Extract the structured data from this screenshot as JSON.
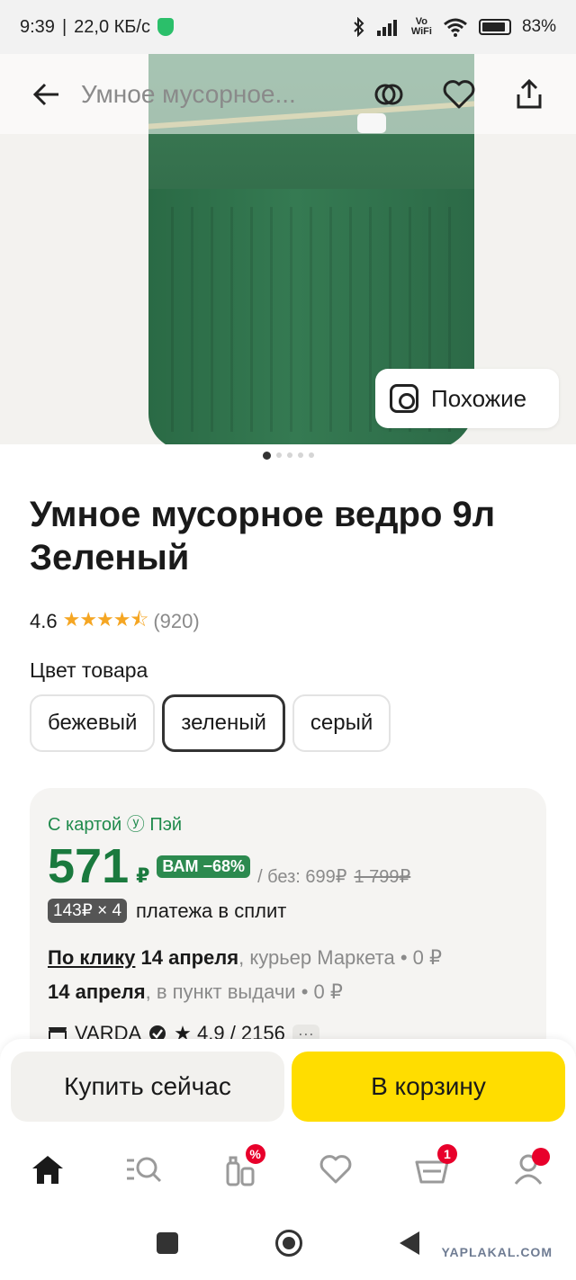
{
  "status_bar": {
    "time": "9:39",
    "net_speed": "22,0 КБ/с",
    "vo_top": "Vo",
    "vo_bottom": "WiFi",
    "battery": "83%"
  },
  "top_nav": {
    "title": "Умное мусорное...",
    "icons": [
      "back-arrow-icon",
      "compare-icon",
      "heart-icon",
      "share-icon"
    ]
  },
  "gallery": {
    "similar_label": "Похожие",
    "pages_total": 5,
    "current_page": 1
  },
  "product": {
    "title": "Умное мусорное ведро 9л Зеленый",
    "rating": "4.6",
    "rating_stars": 4.5,
    "reviews": "(920)",
    "color_label": "Цвет товара",
    "colors": [
      "бежевый",
      "зеленый",
      "серый"
    ],
    "selected_color": "зеленый"
  },
  "price_card": {
    "promo": "С картой ⓨ Пэй",
    "price": "571",
    "currency": "₽",
    "discount_badge": "ВАМ −68%",
    "without_label": "/ без: 699₽",
    "old_price": "1 799₽",
    "split_badge": "143₽ × 4",
    "split_text": "платежа в сплит",
    "delivery1_link": "По клику",
    "delivery1_date": "14 апреля",
    "delivery1_rest": ", курьер Маркета • 0 ₽",
    "delivery2_date": "14 апреля",
    "delivery2_rest": ", в пункт выдачи • 0 ₽",
    "seller_name": "VARDA",
    "seller_rating": "★ 4.9 / 2156",
    "more": "···"
  },
  "actions": {
    "buy_now": "Купить сейчас",
    "to_cart": "В корзину"
  },
  "tab_bar": {
    "tabs": [
      "home-icon",
      "catalog-search-icon",
      "discounts-icon",
      "favorites-icon",
      "cart-icon",
      "profile-icon"
    ],
    "discounts_badge": "%",
    "cart_badge": "1"
  },
  "watermark": "YAPLAKAL.COM",
  "colors": {
    "accent_green": "#1a7a3e",
    "badge_green": "#2c8a4f",
    "cart_yellow": "#ffdd00",
    "badge_red": "#e8002b",
    "star": "#f5a623"
  }
}
